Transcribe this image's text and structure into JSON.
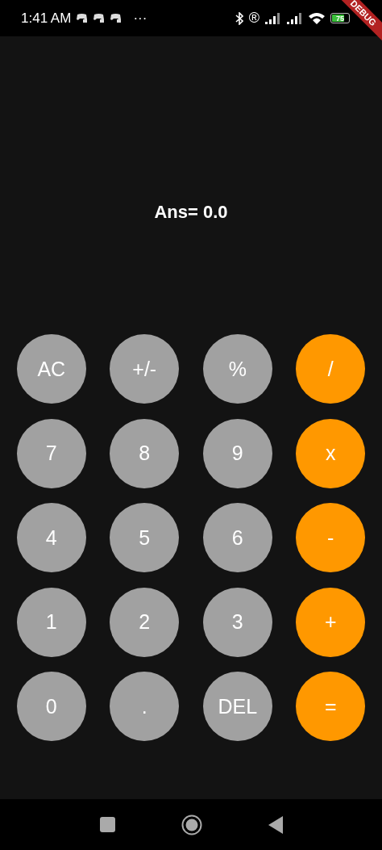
{
  "status_bar": {
    "time": "1:41 AM",
    "more": "···",
    "registered": "®",
    "battery": {
      "text": "75",
      "level": 0.75
    }
  },
  "debug_banner": "DEBUG",
  "display": {
    "result": "Ans= 0.0"
  },
  "keys": [
    {
      "label": "AC",
      "kind": "function"
    },
    {
      "label": "+/-",
      "kind": "function"
    },
    {
      "label": "%",
      "kind": "function"
    },
    {
      "label": "/",
      "kind": "operator"
    },
    {
      "label": "7",
      "kind": "function"
    },
    {
      "label": "8",
      "kind": "function"
    },
    {
      "label": "9",
      "kind": "function"
    },
    {
      "label": "x",
      "kind": "operator"
    },
    {
      "label": "4",
      "kind": "function"
    },
    {
      "label": "5",
      "kind": "function"
    },
    {
      "label": "6",
      "kind": "function"
    },
    {
      "label": "-",
      "kind": "operator"
    },
    {
      "label": "1",
      "kind": "function"
    },
    {
      "label": "2",
      "kind": "function"
    },
    {
      "label": "3",
      "kind": "function"
    },
    {
      "label": "+",
      "kind": "operator"
    },
    {
      "label": "0",
      "kind": "function"
    },
    {
      "label": ".",
      "kind": "function"
    },
    {
      "label": "DEL",
      "kind": "function"
    },
    {
      "label": "=",
      "kind": "operator"
    }
  ]
}
